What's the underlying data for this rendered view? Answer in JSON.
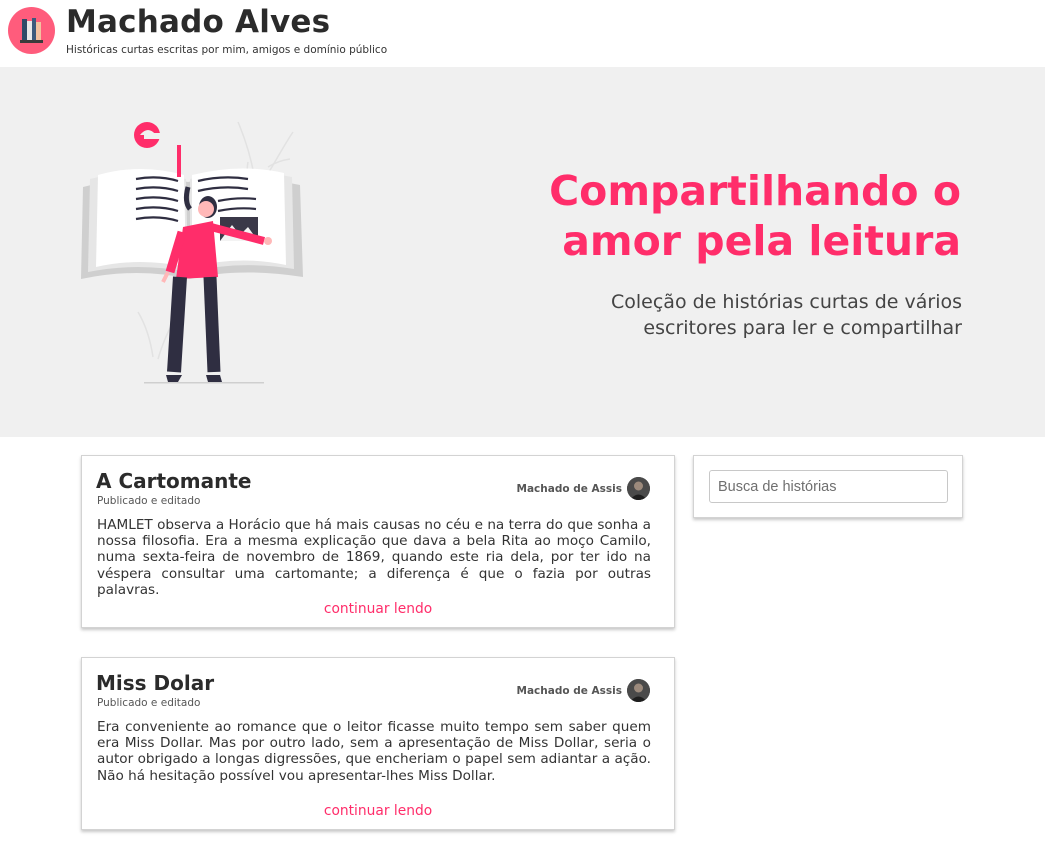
{
  "header": {
    "logo_icon": "books-icon",
    "title": "Machado Alves",
    "tagline": "Históricas curtas escritas por mim, amigos e domínio público"
  },
  "hero": {
    "illustration": "woman-reading-book-illustration",
    "title": "Compartilhando o amor pela leitura",
    "subtitle": "Coleção de histórias curtas de vários escritores para ler e compartilhar"
  },
  "stories": [
    {
      "title": "A Cartomante",
      "meta": "Publicado e editado",
      "author": "Machado de Assis",
      "excerpt": "HAMLET observa a Horácio que há mais causas no céu e na terra do que sonha a nossa filosofia. Era a mesma explicação que dava a bela Rita ao moço Camilo, numa sexta-feira de novembro de 1869, quando este ria dela, por ter ido na véspera consultar uma cartomante; a diferença é que o fazia por outras palavras.",
      "link_label": "continuar lendo"
    },
    {
      "title": "Miss Dolar",
      "meta": "Publicado e editado",
      "author": "Machado de Assis",
      "excerpt": "Era conveniente ao romance que o leitor ficasse muito tempo sem saber quem era Miss Dollar. Mas por outro lado, sem a apresentação de Miss Dollar, seria o autor obrigado a longas digressões, que encheriam o papel sem adiantar a ação. Não há hesitação possível vou apresentar-lhes Miss Dollar.",
      "link_label": "continuar lendo"
    }
  ],
  "search": {
    "placeholder": "Busca de histórias",
    "value": ""
  },
  "colors": {
    "accent": "#ff2d6a",
    "hero_background": "#f0f0f0",
    "logo_background": "#ff5c7c"
  }
}
